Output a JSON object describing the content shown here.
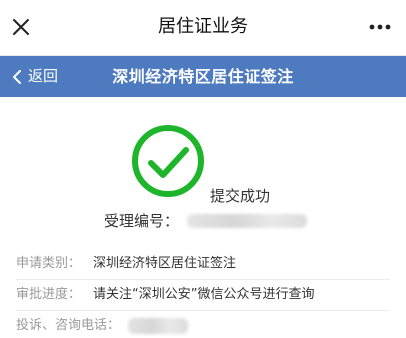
{
  "topbar": {
    "title": "居住证业务",
    "close_icon": "close-icon",
    "more_icon": "more-dots-icon"
  },
  "header": {
    "back_label": "返回",
    "title": "深圳经济特区居住证签注",
    "background_color": "#4e7bbf"
  },
  "result": {
    "icon": "check-circle-icon",
    "icon_color": "#1fb52b",
    "status_text": "提交成功",
    "receipt_label": "受理编号："
  },
  "info": [
    {
      "label": "申请类别：",
      "value": "深圳经济特区居住证签注"
    },
    {
      "label": "审批进度：",
      "value": "请关注“深圳公安”微信公众号进行查询"
    },
    {
      "label": "投诉、咨询电话：",
      "value": ""
    }
  ]
}
